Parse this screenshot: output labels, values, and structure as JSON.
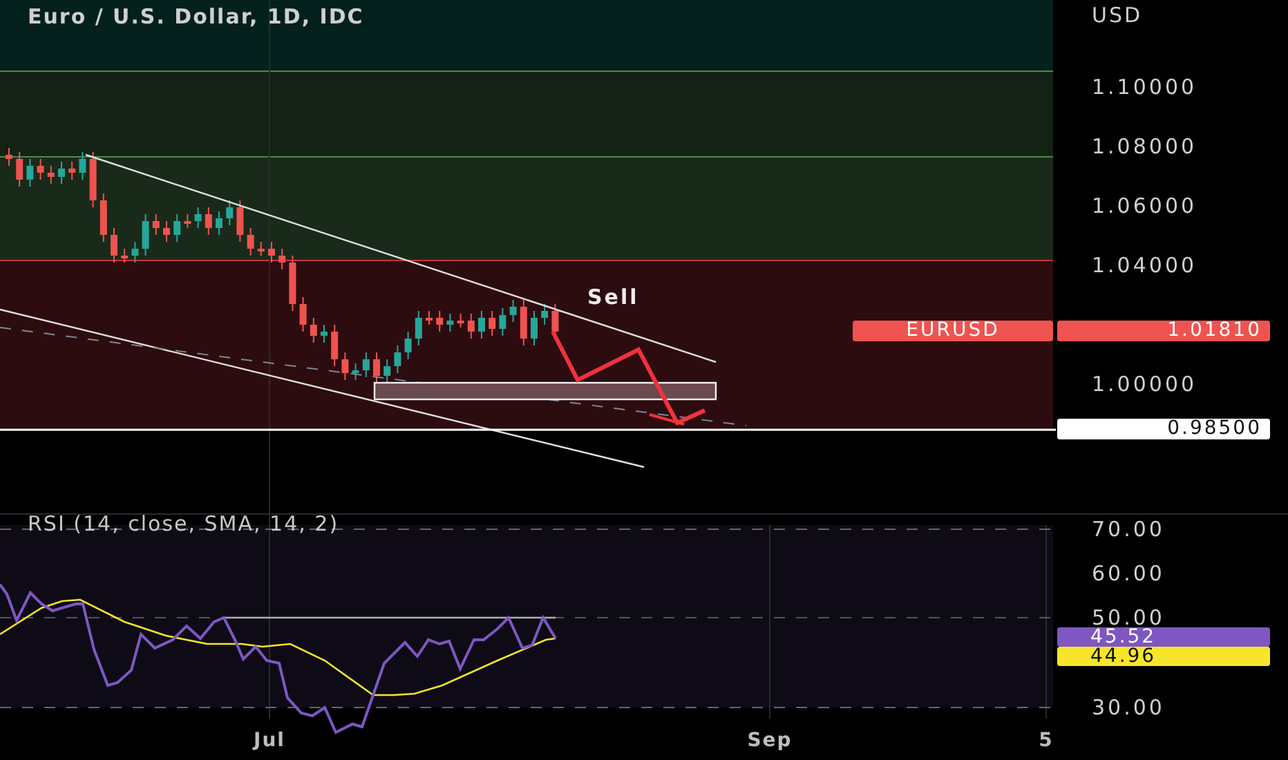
{
  "chart": {
    "title": "Euro / U.S. Dollar, 1D, IDC",
    "currency": "USD",
    "price_labels": [
      "1.10000",
      "1.08000",
      "1.06000",
      "1.04000",
      "1.00000"
    ],
    "annotation": "Sell",
    "symbol_badge": "EURUSD",
    "last_price": "1.01810",
    "target_price": "0.98500"
  },
  "rsi": {
    "title": "RSI (14, close, SMA, 14, 2)",
    "axis_labels": [
      "70.00",
      "60.00",
      "50.00",
      "30.00"
    ],
    "rsi_value": "45.52",
    "sma_value": "44.96"
  },
  "time_axis": [
    "Jul",
    "Sep",
    "5"
  ]
}
